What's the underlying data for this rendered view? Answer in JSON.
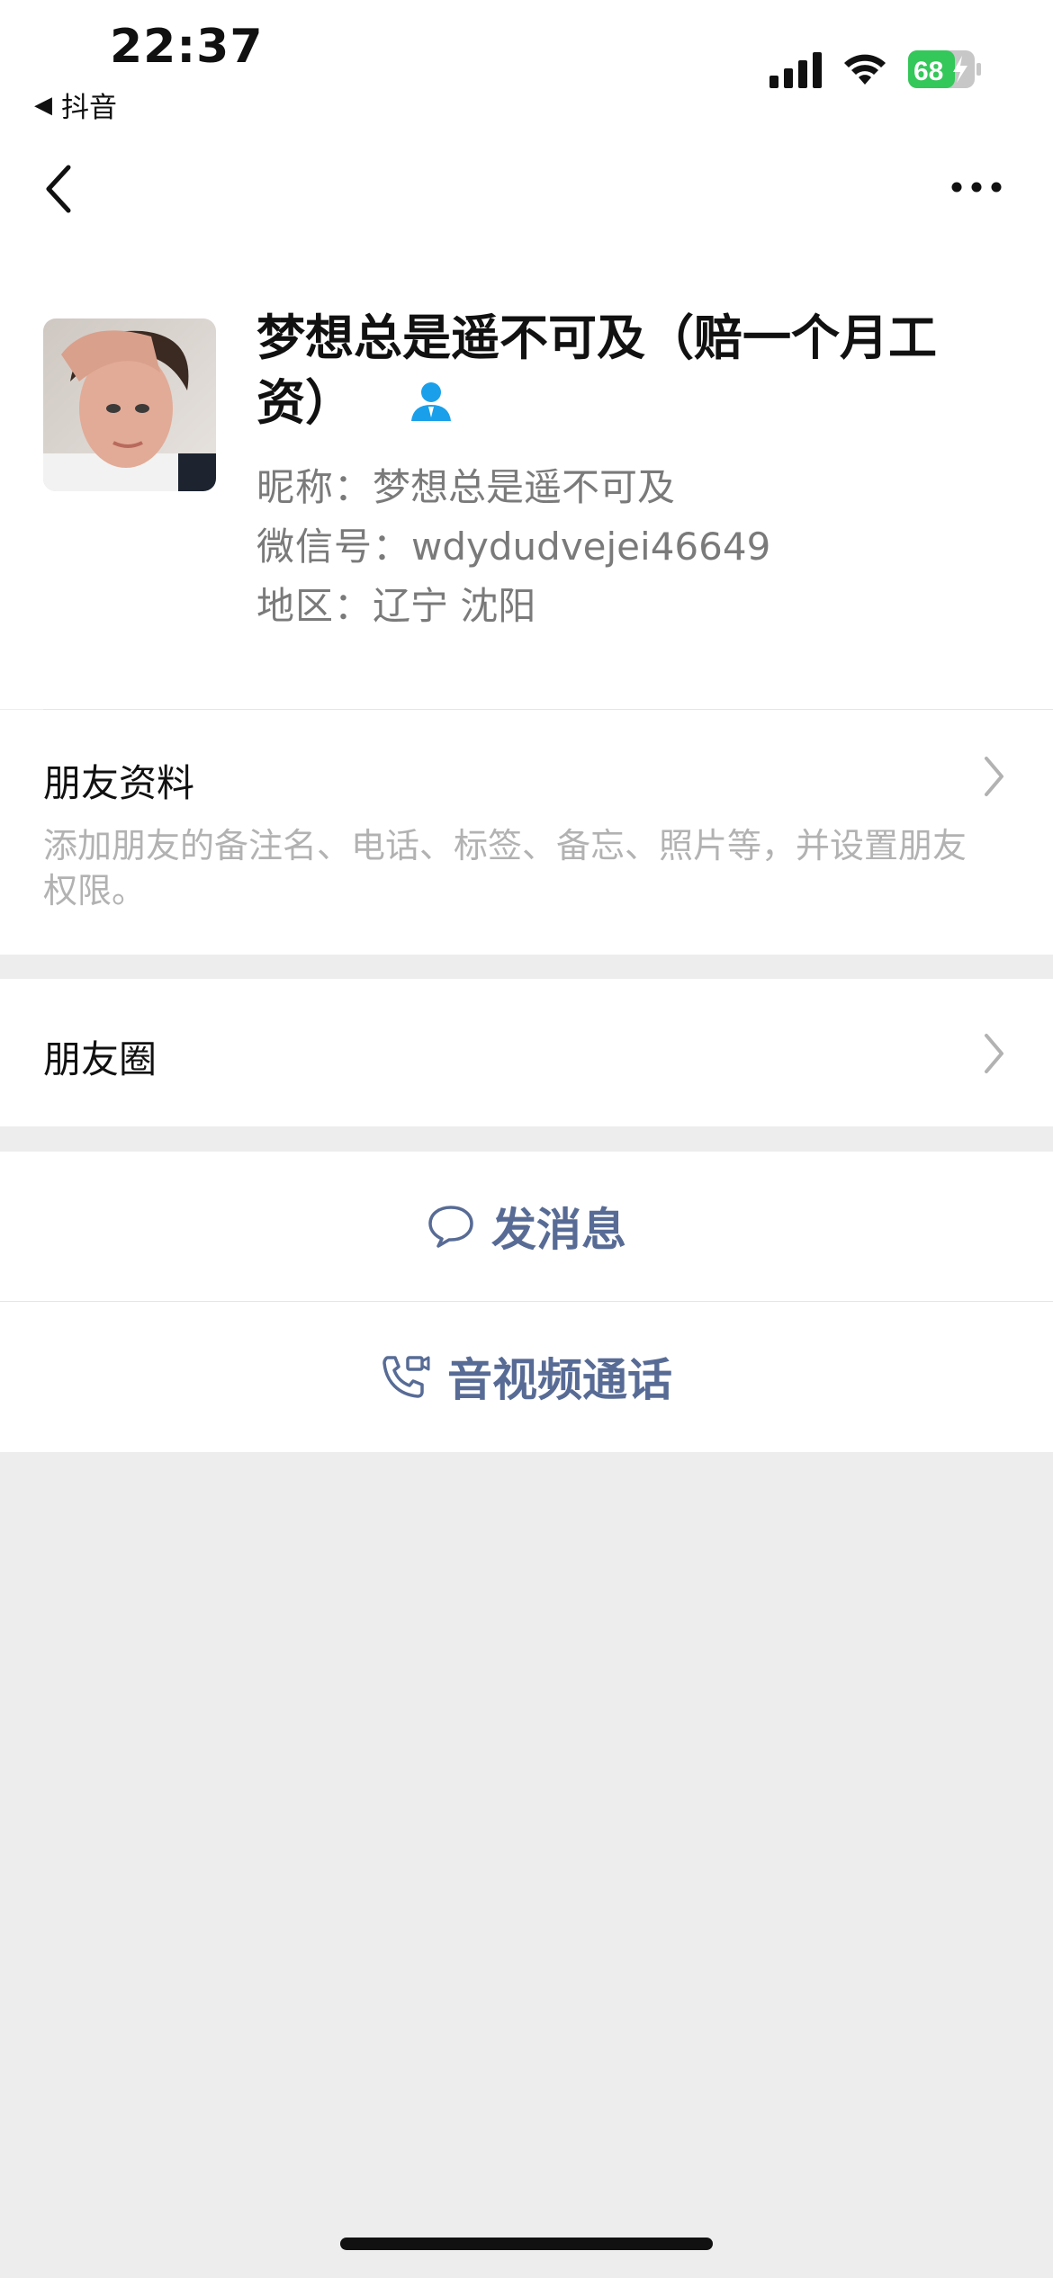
{
  "status_bar": {
    "time": "22:37",
    "back_app_label": "抖音",
    "battery_level": "68",
    "icons": [
      "signal-icon",
      "wifi-icon",
      "battery-charging-icon"
    ]
  },
  "nav": {
    "back_icon": "chevron-left-icon",
    "more_icon": "more-dots-icon"
  },
  "profile": {
    "display_name": "梦想总是遥不可及（赔一个月工资）",
    "badge_icon": "contact-person-icon",
    "nickname_label": "昵称：",
    "nickname": "梦想总是遥不可及",
    "wechat_id_label": "微信号：",
    "wechat_id": "wdydudvejei46649",
    "region_label": "地区：",
    "region": "辽宁 沈阳"
  },
  "friend_info": {
    "title": "朋友资料",
    "description": "添加朋友的备注名、电话、标签、备忘、照片等，并设置朋友权限。"
  },
  "moments": {
    "title": "朋友圈"
  },
  "actions": {
    "message": "发消息",
    "call": "音视频通话"
  },
  "colors": {
    "link_blue": "#576b95",
    "badge_blue": "#1aa0ea",
    "battery_green": "#34c759",
    "background_gray": "#ededed"
  }
}
